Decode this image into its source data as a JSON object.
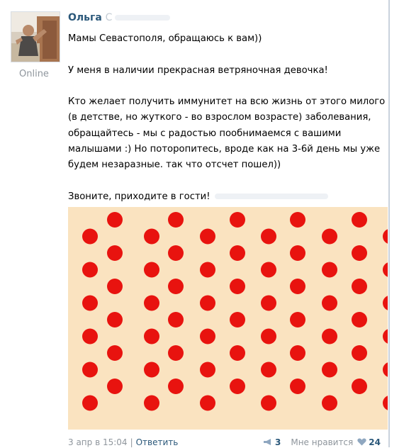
{
  "post": {
    "author_first": "Ольга",
    "author_surname": "С",
    "status": "Online",
    "paragraphs": [
      "Мамы Севастополя, обращаюсь к вам))",
      "",
      "У меня в наличии прекрасная ветряночная девочка!",
      "",
      "Кто желает получить иммунитет на всю жизнь от этого милого",
      "(в детстве, но жуткого - во взрослом возрасте) заболевания,",
      "обращайтесь - мы с радостью пообнимаемся с вашими",
      "малышами :) Но поторопитесь, вроде как на 3-6й день мы уже",
      "будем незаразные. так что отсчет пошел))",
      "",
      "Звоните, приходите в гости!"
    ],
    "attachment": {
      "background_color": "#fae3c0",
      "dot_color": "#e8130f",
      "description_kind": "image"
    }
  },
  "footer": {
    "date": "3 апр в 15:04",
    "separator": "|",
    "reply": "Ответить",
    "share_count": "3",
    "like_label": "Мне нравится",
    "like_count": "24",
    "icons": [
      "megaphone-icon",
      "heart-icon"
    ]
  }
}
